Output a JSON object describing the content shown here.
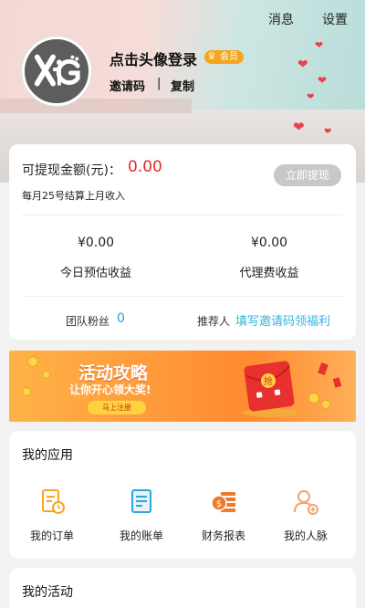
{
  "header": {
    "messages_label": "消息",
    "settings_label": "设置",
    "avatar_text": "XiG",
    "login_title": "点击头像登录",
    "member_badge": "会员",
    "invite_code_label": "邀请码",
    "divider": "|",
    "copy_label": "复制"
  },
  "earnings": {
    "withdrawable_label": "可提现金额(元)：",
    "withdrawable_amount": "0.00",
    "withdraw_button": "立即提现",
    "settlement_note": "每月25号结算上月收入",
    "stats": [
      {
        "value": "¥0.00",
        "label": "今日预估收益"
      },
      {
        "value": "¥0.00",
        "label": "代理费收益"
      }
    ],
    "team_fans_label": "团队粉丝",
    "team_fans_count": "0",
    "referrer_label": "推荐人",
    "referrer_link": "填写邀请码领福利"
  },
  "banner": {
    "title": "活动攻略",
    "subtitle": "让你开心领大奖!",
    "button": "马上注册",
    "envelope_char": "抢"
  },
  "my_apps": {
    "title": "我的应用",
    "items": [
      {
        "label": "我的订单",
        "icon": "order-icon"
      },
      {
        "label": "我的账单",
        "icon": "bill-icon"
      },
      {
        "label": "财务报表",
        "icon": "finance-report-icon"
      },
      {
        "label": "我的人脉",
        "icon": "contacts-icon"
      }
    ]
  },
  "my_activities": {
    "title": "我的活动"
  },
  "colors": {
    "accent_orange": "#f5a51f",
    "amount_red": "#e5282b",
    "link_blue": "#2fb5e0",
    "heart_red": "#e8414f"
  }
}
